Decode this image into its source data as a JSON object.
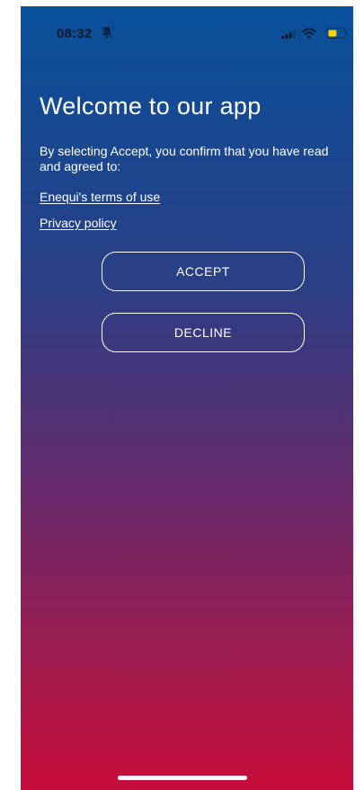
{
  "status_bar": {
    "time": "08:32",
    "icons": [
      "bell-off-icon",
      "signal-icon",
      "wifi-icon",
      "battery-icon"
    ]
  },
  "welcome": {
    "title": "Welcome to our app",
    "consent_text": "By selecting Accept, you confirm that you have read and agreed to:",
    "terms_link": "Enequi's terms of use",
    "privacy_link": "Privacy policy"
  },
  "actions": {
    "accept_label": "ACCEPT",
    "decline_label": "DECLINE"
  },
  "colors": {
    "gradient_top": "#08509a",
    "gradient_mid": "#67296a",
    "gradient_bottom": "#c70d3a",
    "battery_level": "#ffd400"
  }
}
